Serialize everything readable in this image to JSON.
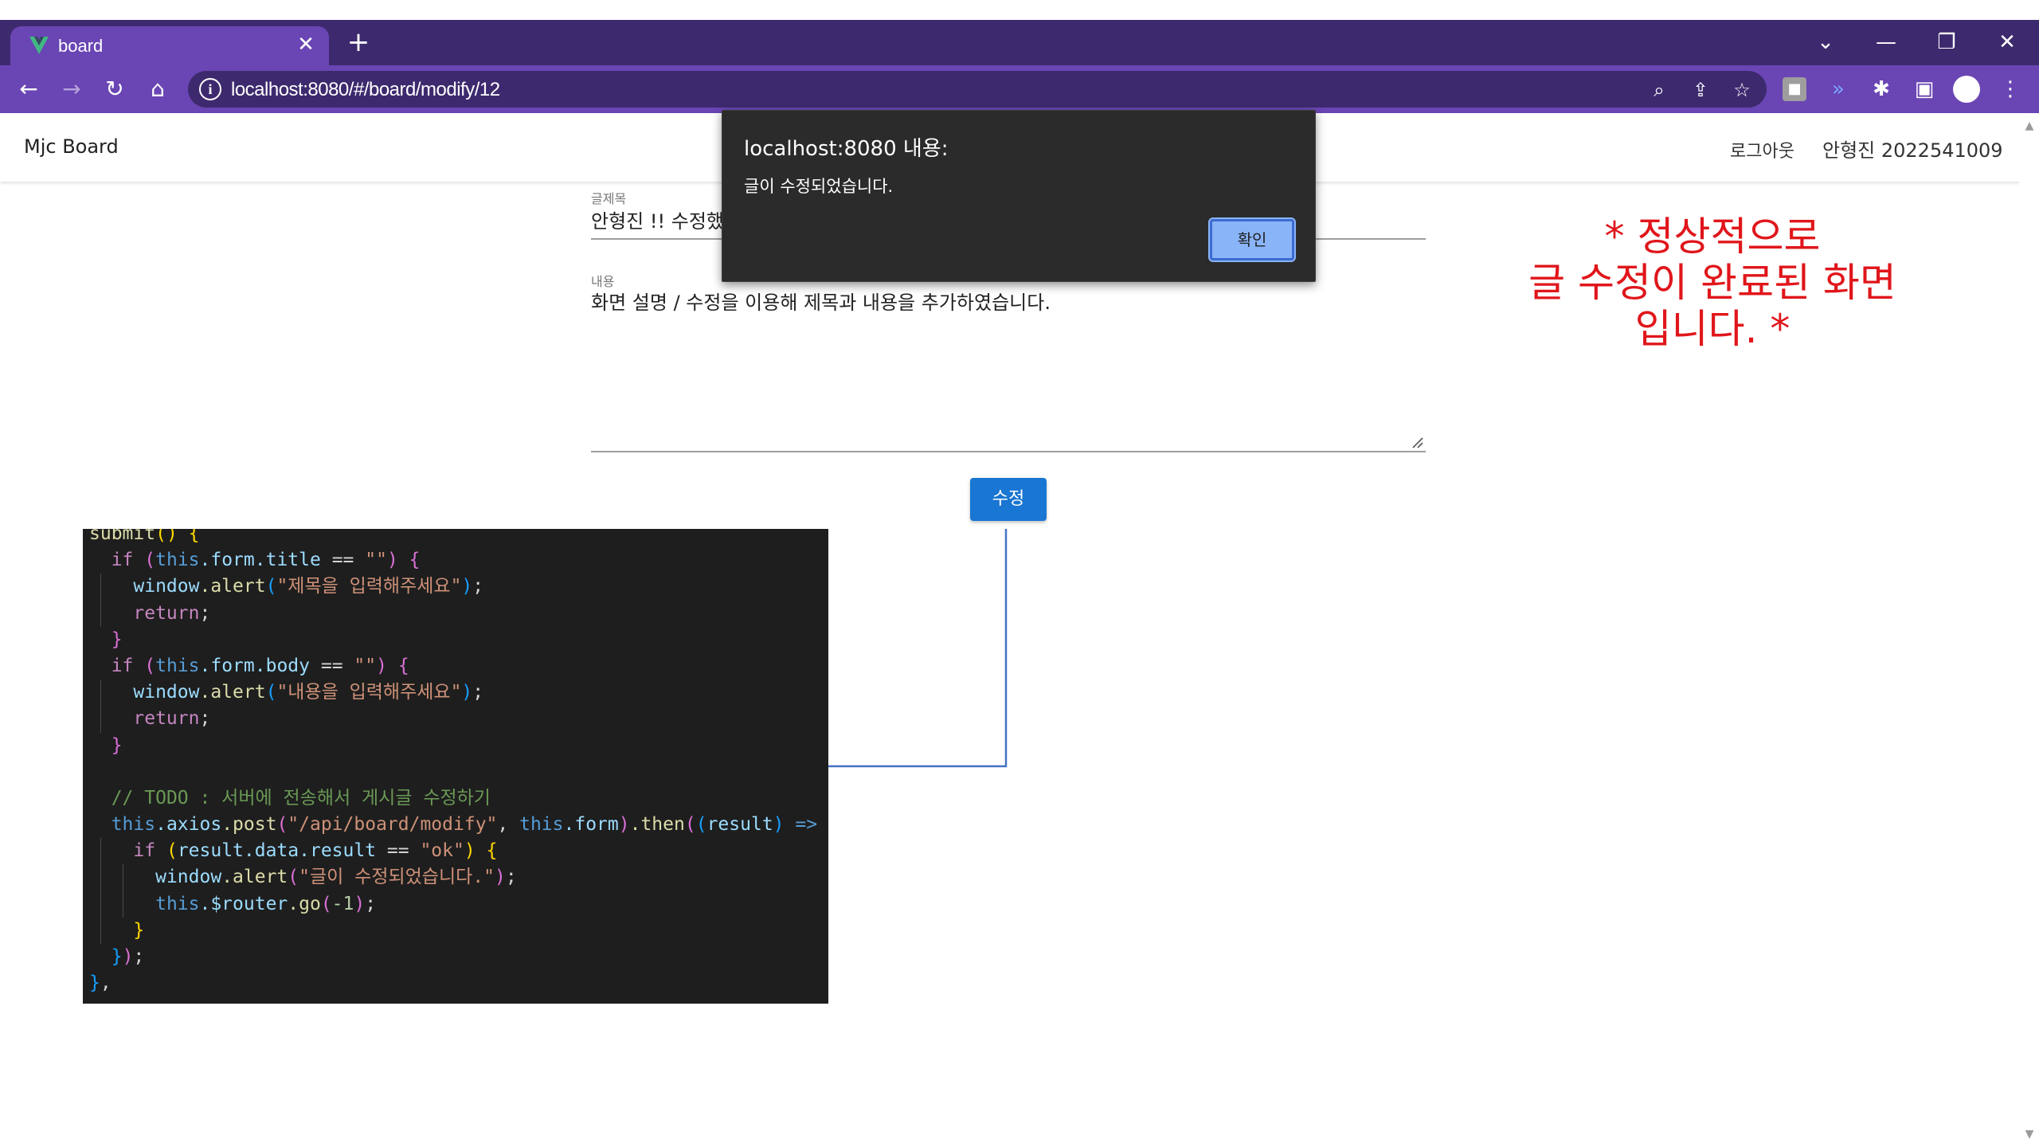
{
  "browser": {
    "tab_title": "board",
    "url": "localhost:8080/#/board/modify/12",
    "colors": {
      "frame": "#3d2a6e",
      "toolbar": "#6a45b4"
    }
  },
  "header": {
    "brand": "Mjc Board",
    "logout": "로그아웃",
    "user": "안형진 2022541009"
  },
  "form": {
    "title_label": "글제목",
    "title_value": "안형진 !! 수정했",
    "body_label": "내용",
    "body_value": "화면 설명 / 수정을 이용해 제목과 내용을 추가하였습니다.",
    "submit_label": "수정"
  },
  "annotation": {
    "line1": "* 정상적으로",
    "line2": "글 수정이 완료된 화면",
    "line3": "입니다. *",
    "color": "#e0161b"
  },
  "dialog": {
    "title": "localhost:8080 내용:",
    "message": "글이 수정되었습니다.",
    "ok_label": "확인"
  },
  "code": {
    "l1_fn": "submit",
    "l2_kw": "if",
    "l2_this": "this",
    "l2_prop": ".form.title",
    "l2_op": " == ",
    "l2_str": "\"\"",
    "l3_obj": "window",
    "l3_fn": ".alert",
    "l3_str": "\"제목을 입력해주세요\"",
    "l4_kw": "return",
    "l6_kw": "if",
    "l6_this": "this",
    "l6_prop": ".form.body",
    "l6_op": " == ",
    "l6_str": "\"\"",
    "l7_obj": "window",
    "l7_fn": ".alert",
    "l7_str": "\"내용을 입력해주세요\"",
    "l8_kw": "return",
    "l11_cmt": "// TODO : 서버에 전송해서 게시글 수정하기",
    "l12_this": "this",
    "l12_prop": ".axios",
    "l12_fn": ".post",
    "l12_str": "\"/api/board/modify\"",
    "l12_this2": "this",
    "l12_prop2": ".form",
    "l12_fn2": ".then",
    "l12_param": "result",
    "l12_arrow": " => ",
    "l13_kw": "if",
    "l13_prop": "result.data.result",
    "l13_op": " == ",
    "l13_str": "\"ok\"",
    "l14_obj": "window",
    "l14_fn": ".alert",
    "l14_str": "\"글이 수정되었습니다.\"",
    "l15_this": "this",
    "l15_prop": ".$router",
    "l15_fn": ".go",
    "l15_num": "-1"
  }
}
